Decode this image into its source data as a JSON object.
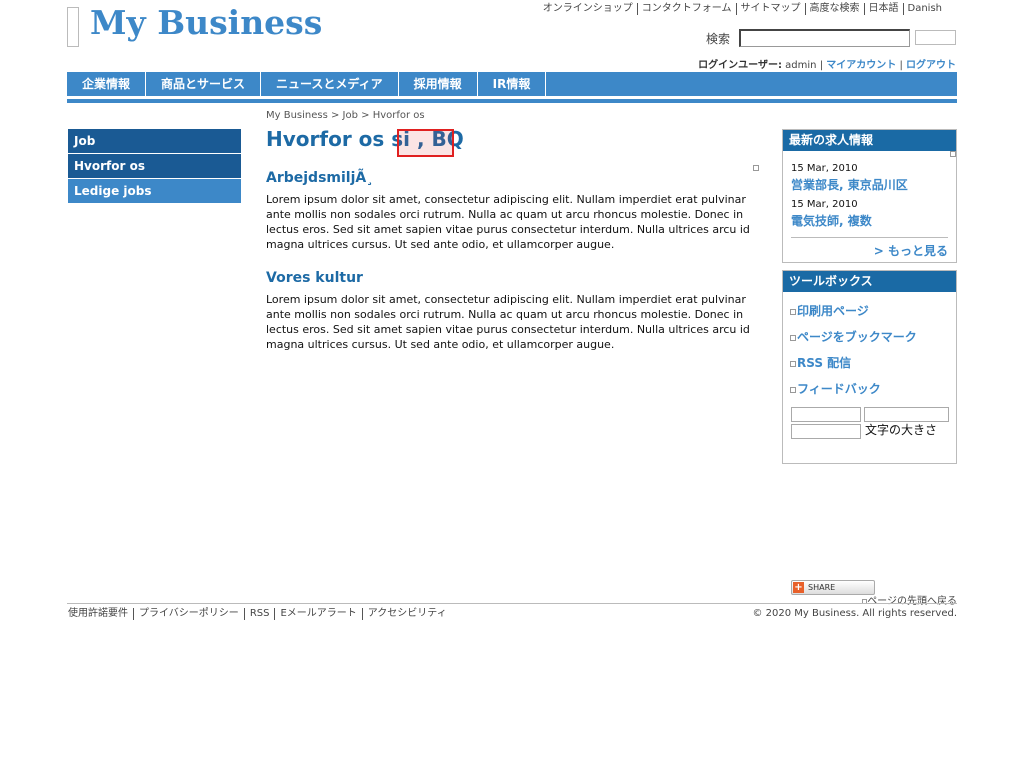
{
  "header": {
    "logo": "My Business",
    "top_links": [
      "オンラインショップ",
      "コンタクトフォーム",
      "サイトマップ",
      "高度な検索",
      "日本語",
      "Danish"
    ],
    "search_label": "検索",
    "search_value": "",
    "login_label": "ログインユーザー:",
    "login_user": "admin",
    "my_account": "マイアカウント",
    "logout": "ログアウト",
    "separator": "|"
  },
  "nav": [
    "企業情報",
    "商品とサービス",
    "ニュースとメディア",
    "採用情報",
    "IR情報"
  ],
  "sidebar": [
    "Job",
    "Hvorfor os",
    "Ledige jobs"
  ],
  "main": {
    "breadcrumb": "My Business > Job > Hvorfor os",
    "title": "Hvorfor os si , BQ",
    "sections": [
      {
        "heading": "ArbejdsmiljÃ¸",
        "body": "Lorem ipsum dolor sit amet, consectetur adipiscing elit. Nullam imperdiet erat pulvinar ante mollis non sodales orci rutrum. Nulla ac quam ut arcu rhoncus molestie. Donec in lectus eros. Sed sit amet sapien vitae purus consectetur interdum. Nulla ultrices arcu id magna ultrices cursus. Ut sed ante odio, et ullamcorper augue."
      },
      {
        "heading": "Vores kultur",
        "body": "Lorem ipsum dolor sit amet, consectetur adipiscing elit. Nullam imperdiet erat pulvinar ante mollis non sodales orci rutrum. Nulla ac quam ut arcu rhoncus molestie. Donec in lectus eros. Sed sit amet sapien vitae purus consectetur interdum. Nulla ultrices arcu id magna ultrices cursus. Ut sed ante odio, et ullamcorper augue."
      }
    ]
  },
  "jobs_widget": {
    "title": "最新の求人情報",
    "jobs": [
      {
        "date": "15 Mar, 2010",
        "title": "営業部長, 東京品川区"
      },
      {
        "date": "15 Mar, 2010",
        "title": "電気技師, 複数"
      }
    ],
    "more": "> もっと見る"
  },
  "toolbox": {
    "title": "ツールボックス",
    "links": [
      "印刷用ページ",
      "ページをブックマーク",
      "RSS 配信",
      "フィードバック"
    ],
    "font_size_label": "文字の大きさ",
    "share_label": "SHARE"
  },
  "footer": {
    "back_to_top": "ページの先頭へ戻る",
    "links": [
      "使用許諾要件",
      "プライバシーポリシー",
      "RSS",
      "Eメールアラート",
      "アクセシビリティ"
    ],
    "copyright": "© 2020 My Business. All rights reserved."
  },
  "colors": {
    "accent": "#3d88c8",
    "nav_dark": "#1a5a94",
    "highlight": "#e02020"
  }
}
